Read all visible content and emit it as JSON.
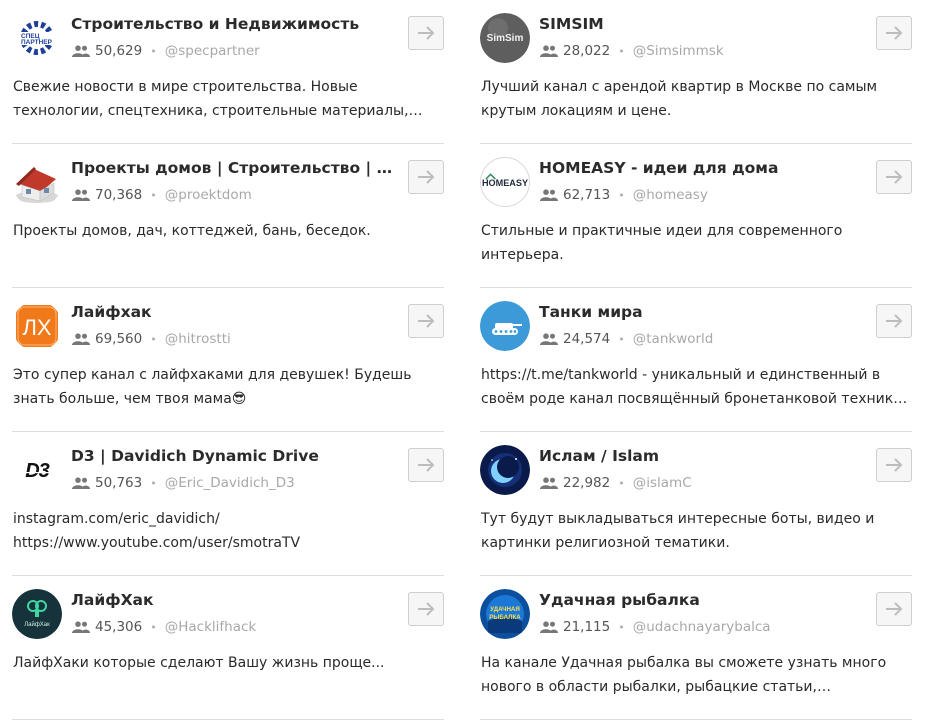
{
  "channels": [
    {
      "title": "Строительство и Недвижимость",
      "subscribers": "50,629",
      "handle": "@specpartner",
      "description": "Свежие новости в мире строительства. Новые технологии, спецтехника, строительные материалы, оборудование. Сотрудничество и реклама.",
      "avatar": "gear-logo-icon",
      "avatar_text": "СПЕЦ ПАРТНЕР"
    },
    {
      "title": "SIMSIM",
      "subscribers": "28,022",
      "handle": "@Simsimmsk",
      "description": "Лучший канал с арендой квартир в Москве по самым крутым локациям и цене.",
      "avatar": "simsim-logo-icon",
      "avatar_text": "SimSim"
    },
    {
      "title": "Проекты домов | Строительство | Планировки",
      "subscribers": "70,368",
      "handle": "@proektdom",
      "description": "Проекты домов, дач, коттеджей, бань, беседок.",
      "avatar": "house-icon"
    },
    {
      "title": "HOMEASY - идеи для дома",
      "subscribers": "62,713",
      "handle": "@homeasy",
      "description": "Стильные и практичные идеи для современного интерьера.",
      "avatar": "homeasy-logo-icon",
      "avatar_text": "HOMEASY"
    },
    {
      "title": "Лайфхак",
      "subscribers": "69,560",
      "handle": "@hitrostti",
      "description": "Это супер канал с лайфхаками для девушек! Будешь знать больше, чем твоя мама😎",
      "avatar": "lh-logo-icon",
      "avatar_text": "ЛХ"
    },
    {
      "title": "Танки мира",
      "subscribers": "24,574",
      "handle": "@tankworld",
      "description": "https://t.me/tankworld - уникальный и единственный в своём роде канал посвящённый бронетанковой технике мира.",
      "avatar": "tank-icon"
    },
    {
      "title": "D3 | Davidich Dynamic Drive",
      "subscribers": "50,763",
      "handle": "@Eric_Davidich_D3",
      "description": "instagram.com/eric_davidich/ https://www.youtube.com/user/smotraTV",
      "avatar": "d3-logo-icon",
      "avatar_text": "D3"
    },
    {
      "title": "Ислам / Islam",
      "subscribers": "22,982",
      "handle": "@islamC",
      "description": "Тут будут выкладываться интересные боты, видео и картинки религиозной тематики.",
      "avatar": "crescent-moon-icon"
    },
    {
      "title": "ЛайфХак",
      "subscribers": "45,306",
      "handle": "@Hacklifhack",
      "description": "ЛайфХаки которые сделают Вашу жизнь проще...",
      "avatar": "lifehack-logo-icon",
      "avatar_text": "ЛайфХак"
    },
    {
      "title": "Удачная рыбалка",
      "subscribers": "21,115",
      "handle": "@udachnayarybalca",
      "description": "На канале Удачная рыбалка вы сможете узнать много нового в области рыбалки, рыбацкие статьи, фотографии, видео.",
      "avatar": "fishing-logo-icon",
      "avatar_text": "УДАЧНАЯ РЫБАЛКА"
    }
  ],
  "colors": {
    "title": "#2b2b2b",
    "handle": "#a8a8a8",
    "divider": "#dedede",
    "button_border": "#cfcfcf"
  }
}
